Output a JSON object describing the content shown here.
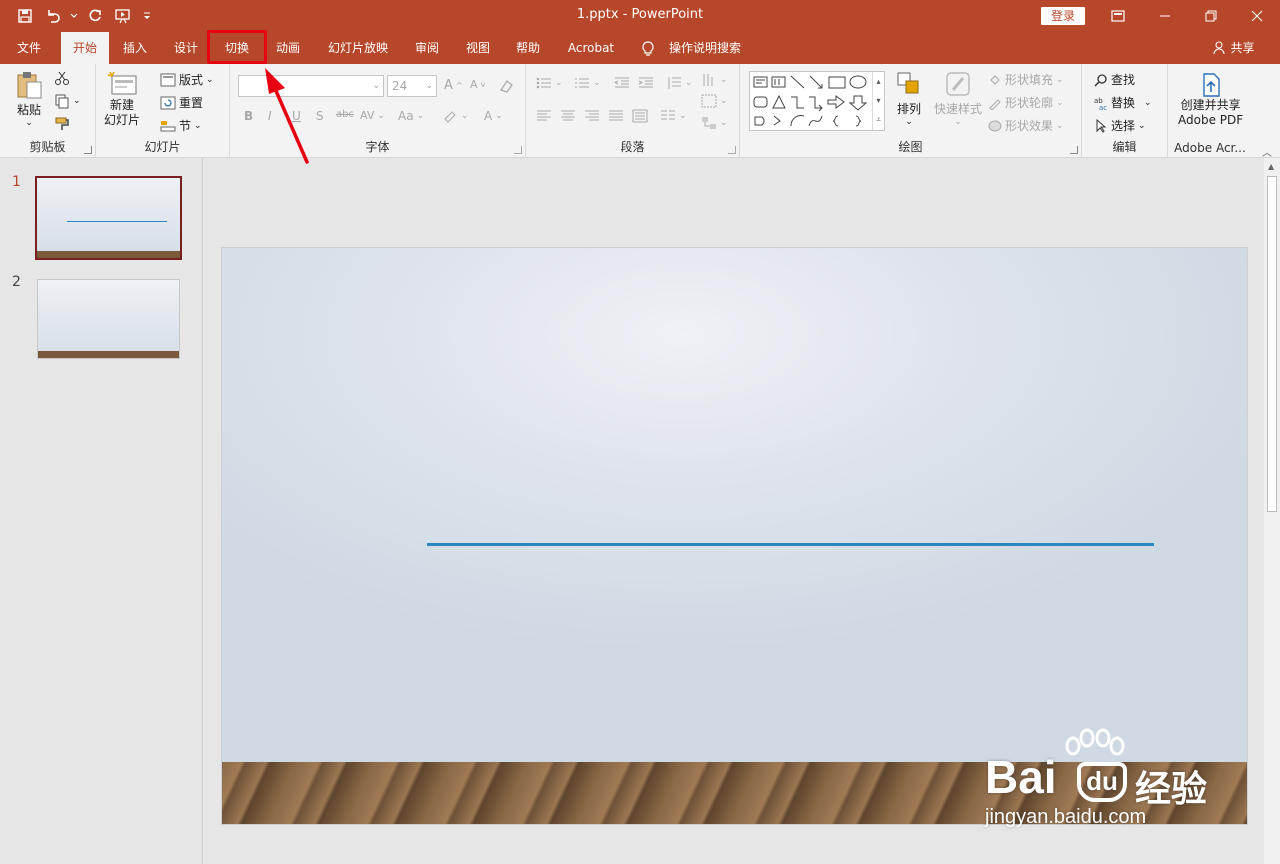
{
  "window": {
    "title": "1.pptx  -  PowerPoint",
    "login_label": "登录"
  },
  "tabs": [
    {
      "label": "文件"
    },
    {
      "label": "开始",
      "active": true
    },
    {
      "label": "插入"
    },
    {
      "label": "设计"
    },
    {
      "label": "切换",
      "highlighted": true
    },
    {
      "label": "动画"
    },
    {
      "label": "幻灯片放映"
    },
    {
      "label": "审阅"
    },
    {
      "label": "视图"
    },
    {
      "label": "帮助"
    },
    {
      "label": "Acrobat"
    }
  ],
  "tell_me": "操作说明搜索",
  "share": "共享",
  "ribbon": {
    "clipboard": {
      "paste": "粘贴",
      "label": "剪贴板"
    },
    "slides": {
      "new_slide_1": "新建",
      "new_slide_2": "幻灯片",
      "layout": "版式",
      "reset": "重置",
      "section": "节",
      "label": "幻灯片"
    },
    "font": {
      "size": "24",
      "label": "字体"
    },
    "paragraph": {
      "label": "段落"
    },
    "drawing": {
      "arrange": "排列",
      "quick_styles": "快速样式",
      "shape_fill": "形状填充",
      "shape_outline": "形状轮廓",
      "shape_effects": "形状效果",
      "label": "绘图"
    },
    "editing": {
      "find": "查找",
      "replace": "替换",
      "select": "选择",
      "label": "编辑"
    },
    "adobe": {
      "create_1": "创建并共享",
      "create_2": "Adobe PDF",
      "label": "Adobe Acr..."
    }
  },
  "slides_panel": {
    "numbers": [
      "1",
      "2"
    ]
  },
  "watermark": {
    "brand": "Bai",
    "brand2": "经验",
    "url": "jingyan.baidu.com"
  },
  "colors": {
    "accent": "#b7472a",
    "highlight": "#e60012",
    "slide_line": "#2e86c1"
  }
}
